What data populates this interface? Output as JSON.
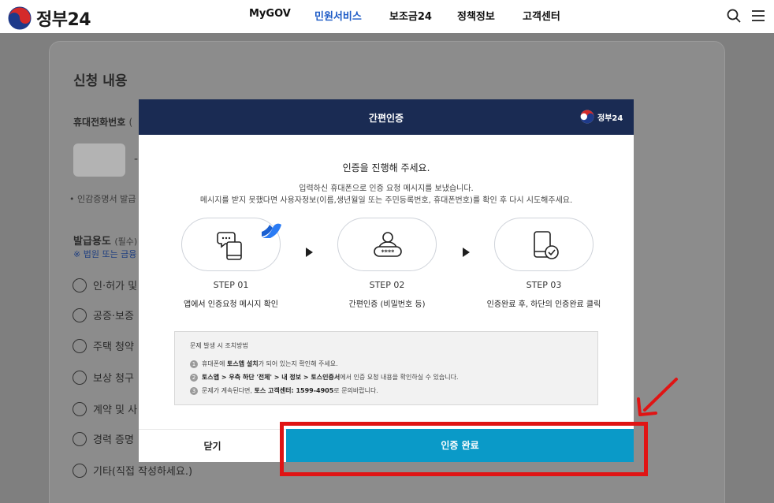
{
  "header": {
    "logo_text": "정부24",
    "nav": [
      "MyGOV",
      "민원서비스",
      "보조금24",
      "정책정보",
      "고객센터"
    ],
    "active_nav": "민원서비스",
    "icons": [
      "search-icon",
      "hamburger-menu-icon"
    ]
  },
  "background": {
    "section_title": "신청 내용",
    "phone_label": "휴대전화번호",
    "phone_label_sub": "(",
    "phone_dash": "-",
    "cert_note": "• 인감증명서 발급",
    "purpose_label": "발급용도",
    "purpose_req": "(필수)",
    "purpose_note": "※ 법원 또는 금융",
    "options": [
      "인·허가 및",
      "공증·보증",
      "주택 청약",
      "보상 청구",
      "계약 및 사",
      "경력 증명",
      "기타(직접 작성하세요.)"
    ]
  },
  "modal": {
    "title": "간편인증",
    "logo_text": "정부24",
    "heading": "인증을 진행해 주세요.",
    "desc1": "입력하신 휴대폰으로 인증 요청 메시지를 보냈습니다.",
    "desc2": "메시지를 받지 못했다면 사용자정보(이름,생년월일 또는 주민등록번호, 휴대폰번호)를 확인 후 다시 시도해주세요.",
    "steps": [
      {
        "label": "STEP 01",
        "desc": "앱에서 인증요청 메시지 확인",
        "icon": "phone-message-icon"
      },
      {
        "label": "STEP 02",
        "desc": "간편인증 (비밀번호 등)",
        "icon": "password-user-icon"
      },
      {
        "label": "STEP 03",
        "desc": "인증완료 후, 하단의 인증완료 클릭",
        "icon": "phone-check-icon"
      }
    ],
    "help": {
      "title": "문제 발생 시 조치방법",
      "items": [
        {
          "num": "1",
          "pre": "휴대폰에 ",
          "bold": "토스앱 설치",
          "post": "가 되어 있는지 확인해 주세요."
        },
        {
          "num": "2",
          "pre": "",
          "bold": "토스앱 > 우측 하단 '전체' > 내 정보 > 토스인증서",
          "post": "에서 인증 요청 내용을 확인하실 수 있습니다."
        },
        {
          "num": "3",
          "pre": "문제가 계속된다면, ",
          "bold": "토스 고객센터: 1599-4905",
          "post": "로 문의바랍니다."
        }
      ]
    },
    "close_label": "닫기",
    "confirm_label": "인증 완료"
  },
  "colors": {
    "header_navy": "#1a2b53",
    "confirm_blue": "#0a9ac8",
    "active_nav": "#1e5bc6",
    "highlight_red": "#e01414"
  }
}
